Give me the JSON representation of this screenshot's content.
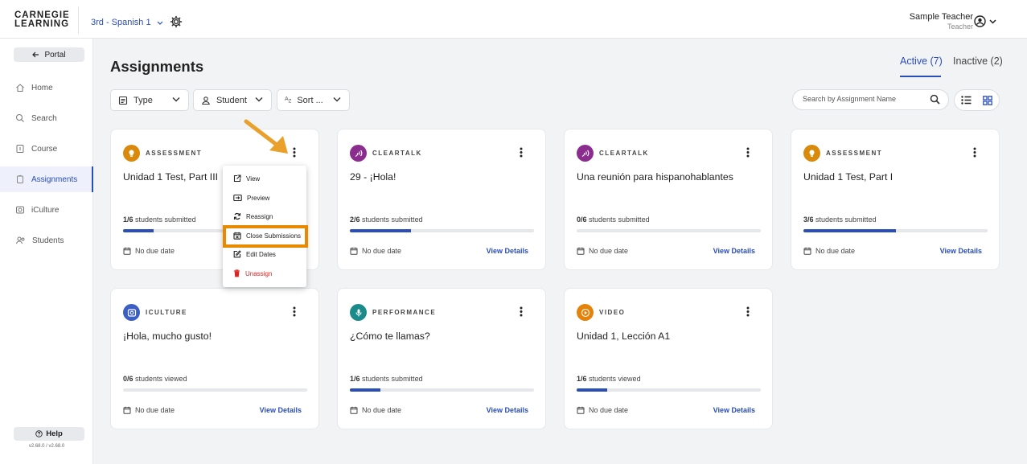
{
  "brand": {
    "line1": "CARNEGIE",
    "line2": "LEARNING"
  },
  "header": {
    "course": "3rd - Spanish 1",
    "user_name": "Sample Teacher",
    "user_role": "Teacher"
  },
  "sidebar": {
    "portal_label": "Portal",
    "items": [
      {
        "label": "Home",
        "icon": "home-icon"
      },
      {
        "label": "Search",
        "icon": "search-icon"
      },
      {
        "label": "Course",
        "icon": "course-icon"
      },
      {
        "label": "Assignments",
        "icon": "assignments-icon",
        "active": true
      },
      {
        "label": "iCulture",
        "icon": "iculture-icon"
      },
      {
        "label": "Students",
        "icon": "students-icon"
      }
    ],
    "help_label": "Help",
    "version": "v2.68.0 / v2.68.0"
  },
  "page": {
    "title": "Assignments",
    "tabs": [
      {
        "label": "Active (7)",
        "active": true
      },
      {
        "label": "Inactive (2)",
        "active": false
      }
    ],
    "filters": [
      {
        "label": "Type"
      },
      {
        "label": "Student"
      },
      {
        "label": "Sort ..."
      }
    ],
    "search_placeholder": "Search by Assignment Name"
  },
  "cards": [
    {
      "type": "ASSESSMENT",
      "color": "#d98a0c",
      "title": "Unidad 1 Test, Part III",
      "count": "1/6",
      "status": "students submitted",
      "progress": 0.167,
      "due": "No due date",
      "link": "View Details"
    },
    {
      "type": "CLEARTALK",
      "color": "#8a2d8f",
      "title": "29 - ¡Hola!",
      "count": "2/6",
      "status": "students submitted",
      "progress": 0.333,
      "due": "No due date",
      "link": "View Details"
    },
    {
      "type": "CLEARTALK",
      "color": "#8a2d8f",
      "title": "Una reunión para hispanohablantes",
      "count": "0/6",
      "status": "students submitted",
      "progress": 0,
      "due": "No due date",
      "link": "View Details"
    },
    {
      "type": "ASSESSMENT",
      "color": "#d98a0c",
      "title": "Unidad 1 Test, Part I",
      "count": "3/6",
      "status": "students submitted",
      "progress": 0.5,
      "due": "No due date",
      "link": "View Details"
    },
    {
      "type": "ICULTURE",
      "color": "#3b5fc4",
      "title": "¡Hola, mucho gusto!",
      "count": "0/6",
      "status": "students viewed",
      "progress": 0,
      "due": "No due date",
      "link": "View Details"
    },
    {
      "type": "PERFORMANCE",
      "color": "#1a8a8a",
      "title": "¿Cómo te llamas?",
      "count": "1/6",
      "status": "students submitted",
      "progress": 0.167,
      "due": "No due date",
      "link": "View Details"
    },
    {
      "type": "VIDEO",
      "color": "#e5820a",
      "title": "Unidad 1, Lección A1",
      "count": "1/6",
      "status": "students viewed",
      "progress": 0.167,
      "due": "No due date",
      "link": "View Details"
    }
  ],
  "context_menu": {
    "items": [
      {
        "label": "View",
        "icon": "open-external-icon"
      },
      {
        "label": "Preview",
        "icon": "preview-icon"
      },
      {
        "label": "Reassign",
        "icon": "reassign-icon"
      },
      {
        "label": "Close Submissions",
        "icon": "close-submissions-icon",
        "highlighted": true
      },
      {
        "label": "Edit Dates",
        "icon": "edit-icon"
      },
      {
        "label": "Unassign",
        "icon": "trash-icon",
        "danger": true
      }
    ]
  },
  "colors": {
    "accent": "#2a4db8",
    "highlight": "#e78a00",
    "danger": "#e02424"
  }
}
